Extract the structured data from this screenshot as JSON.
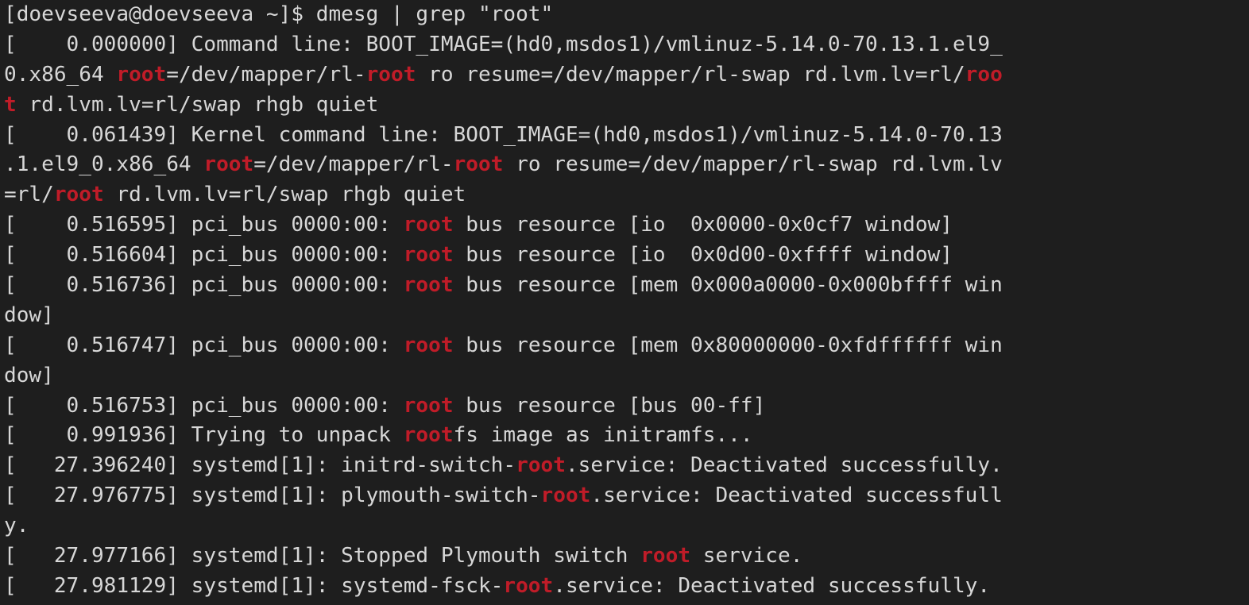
{
  "terminal": {
    "background": "#1e1e1e",
    "foreground": "#d7d7d7",
    "highlight_color": "#c01c28",
    "match_term": "root",
    "lines": [
      [
        {
          "t": "[doevseeva@doevseeva ~]$ dmesg | grep \"root\""
        }
      ],
      [
        {
          "t": "[    0.000000] Command line: BOOT_IMAGE=(hd0,msdos1)/vmlinuz-5.14.0-70.13.1.el9_"
        }
      ],
      [
        {
          "t": "0.x86_64 "
        },
        {
          "t": "root",
          "h": true
        },
        {
          "t": "=/dev/mapper/rl-"
        },
        {
          "t": "root",
          "h": true
        },
        {
          "t": " ro resume=/dev/mapper/rl-swap rd.lvm.lv=rl/"
        },
        {
          "t": "roo",
          "h": true
        }
      ],
      [
        {
          "t": "t",
          "h": true
        },
        {
          "t": " rd.lvm.lv=rl/swap rhgb quiet"
        }
      ],
      [
        {
          "t": "[    0.061439] Kernel command line: BOOT_IMAGE=(hd0,msdos1)/vmlinuz-5.14.0-70.13"
        }
      ],
      [
        {
          "t": ".1.el9_0.x86_64 "
        },
        {
          "t": "root",
          "h": true
        },
        {
          "t": "=/dev/mapper/rl-"
        },
        {
          "t": "root",
          "h": true
        },
        {
          "t": " ro resume=/dev/mapper/rl-swap rd.lvm.lv"
        }
      ],
      [
        {
          "t": "=rl/"
        },
        {
          "t": "root",
          "h": true
        },
        {
          "t": " rd.lvm.lv=rl/swap rhgb quiet"
        }
      ],
      [
        {
          "t": "[    0.516595] pci_bus 0000:00: "
        },
        {
          "t": "root",
          "h": true
        },
        {
          "t": " bus resource [io  0x0000-0x0cf7 window]"
        }
      ],
      [
        {
          "t": "[    0.516604] pci_bus 0000:00: "
        },
        {
          "t": "root",
          "h": true
        },
        {
          "t": " bus resource [io  0x0d00-0xffff window]"
        }
      ],
      [
        {
          "t": "[    0.516736] pci_bus 0000:00: "
        },
        {
          "t": "root",
          "h": true
        },
        {
          "t": " bus resource [mem 0x000a0000-0x000bffff win"
        }
      ],
      [
        {
          "t": "dow]"
        }
      ],
      [
        {
          "t": "[    0.516747] pci_bus 0000:00: "
        },
        {
          "t": "root",
          "h": true
        },
        {
          "t": " bus resource [mem 0x80000000-0xfdffffff win"
        }
      ],
      [
        {
          "t": "dow]"
        }
      ],
      [
        {
          "t": "[    0.516753] pci_bus 0000:00: "
        },
        {
          "t": "root",
          "h": true
        },
        {
          "t": " bus resource [bus 00-ff]"
        }
      ],
      [
        {
          "t": "[    0.991936] Trying to unpack "
        },
        {
          "t": "root",
          "h": true
        },
        {
          "t": "fs image as initramfs..."
        }
      ],
      [
        {
          "t": "[   27.396240] systemd[1]: initrd-switch-"
        },
        {
          "t": "root",
          "h": true
        },
        {
          "t": ".service: Deactivated successfully."
        }
      ],
      [
        {
          "t": "[   27.976775] systemd[1]: plymouth-switch-"
        },
        {
          "t": "root",
          "h": true
        },
        {
          "t": ".service: Deactivated successfull"
        }
      ],
      [
        {
          "t": "y."
        }
      ],
      [
        {
          "t": "[   27.977166] systemd[1]: Stopped Plymouth switch "
        },
        {
          "t": "root",
          "h": true
        },
        {
          "t": " service."
        }
      ],
      [
        {
          "t": "[   27.981129] systemd[1]: systemd-fsck-"
        },
        {
          "t": "root",
          "h": true
        },
        {
          "t": ".service: Deactivated successfully."
        }
      ]
    ]
  }
}
